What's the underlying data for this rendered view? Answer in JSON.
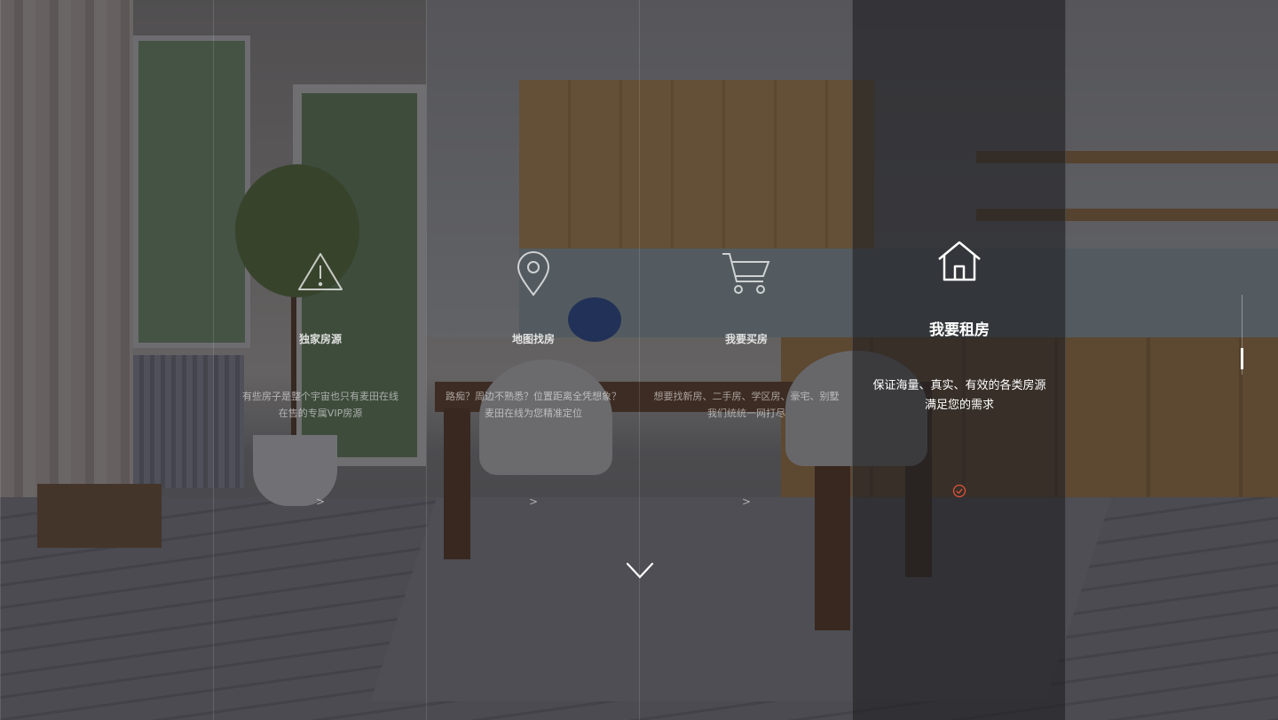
{
  "columns": [
    {
      "title": "独家房源",
      "desc1": "有些房子是整个宇宙也只有麦田在线",
      "desc2": "在售的专属VIP房源",
      "more": ">",
      "icon": "warning-icon",
      "active": false
    },
    {
      "title": "地图找房",
      "desc1": "路痴？周边不熟悉？位置距离全凭想象？",
      "desc2": "麦田在线为您精准定位",
      "more": ">",
      "icon": "map-pin-icon",
      "active": false
    },
    {
      "title": "我要买房",
      "desc1": "想要找新房、二手房、学区房、豪宅、别墅",
      "desc2": "我们统统一网打尽",
      "more": ">",
      "icon": "shopping-cart-icon",
      "active": false
    },
    {
      "title": "我要租房",
      "desc1": "保证海量、真实、有效的各类房源",
      "desc2": "满足您的需求",
      "more": "",
      "icon": "house-icon",
      "active": true
    }
  ],
  "colors": {
    "accent": "#e0533a",
    "text": "#ffffff"
  },
  "scroll_icon": "chevron-down-icon"
}
